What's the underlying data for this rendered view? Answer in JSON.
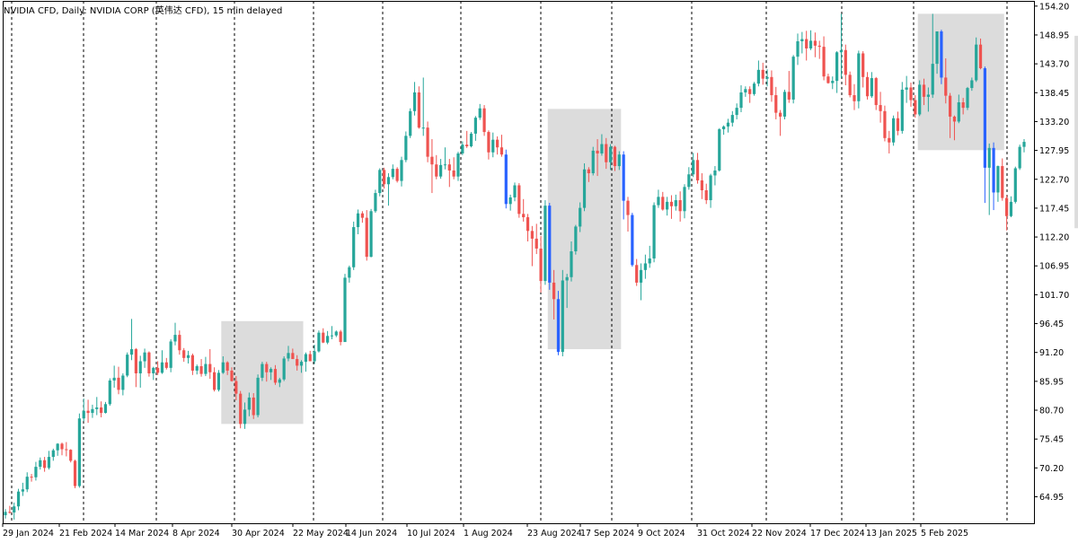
{
  "window": {
    "title": "NVIDIA CFD, Daily:  NVIDIA CORP (英伟达 CFD), 15 min delayed"
  },
  "colors": {
    "up": "#26a69a",
    "down": "#ef5350",
    "down_strong": "#2962ff",
    "box": "#dcdcdc",
    "grid": "#000000",
    "axis": "#000000",
    "background": "#ffffff"
  },
  "chart_data": {
    "type": "candlestick",
    "title": "NVIDIA CFD, Daily:  NVIDIA CORP (英伟达 CFD), 15 min delayed",
    "ylim": [
      60.0,
      155.0
    ],
    "y_ticks": [
      "154.20",
      "148.95",
      "143.70",
      "138.45",
      "133.20",
      "127.95",
      "122.70",
      "117.45",
      "112.20",
      "106.95",
      "101.70",
      "96.45",
      "91.20",
      "85.95",
      "80.70",
      "75.45",
      "70.20",
      "64.95"
    ],
    "x_ticks": [
      "29 Jan 2024",
      "21 Feb 2024",
      "14 Mar 2024",
      "8 Apr 2024",
      "30 Apr 2024",
      "22 May 2024",
      "14 Jun 2024",
      "10 Jul 2024",
      "1 Aug 2024",
      "23 Aug 2024",
      "17 Sep 2024",
      "9 Oct 2024",
      "31 Oct 2024",
      "22 Nov 2024",
      "17 Dec 2024",
      "13 Jan 2025",
      "5 Feb 2025"
    ],
    "grid": "vertical dashed",
    "boxes": [
      {
        "x_start": 50,
        "x_end": 68,
        "y_top": 96.9,
        "y_bottom": 78.2
      },
      {
        "x_start": 125,
        "x_end": 141,
        "y_top": 135.5,
        "y_bottom": 91.8
      },
      {
        "x_start": 210,
        "x_end": 229,
        "y_top": 152.8,
        "y_bottom": 128.0
      },
      {
        "x_start": 246,
        "x_end": 251,
        "y_top": 148.8,
        "y_bottom": 113.8
      }
    ],
    "candles": [
      [
        61.6,
        62.7,
        61.0,
        62.2
      ],
      [
        62.2,
        63.3,
        61.9,
        62.1
      ],
      [
        62.1,
        63.9,
        60.8,
        63.2
      ],
      [
        63.2,
        66.4,
        62.5,
        65.9
      ],
      [
        65.9,
        67.5,
        65.1,
        66.3
      ],
      [
        66.3,
        69.4,
        65.8,
        68.6
      ],
      [
        68.6,
        69.1,
        67.7,
        68.5
      ],
      [
        68.5,
        71.3,
        67.9,
        70.4
      ],
      [
        70.4,
        72.1,
        69.9,
        71.6
      ],
      [
        71.6,
        72.2,
        69.5,
        70.2
      ],
      [
        70.2,
        73.3,
        69.9,
        72.2
      ],
      [
        72.2,
        73.7,
        71.5,
        73.4
      ],
      [
        73.4,
        74.7,
        72.4,
        74.6
      ],
      [
        74.6,
        74.8,
        72.5,
        73.6
      ],
      [
        73.6,
        74.9,
        72.3,
        73.5
      ],
      [
        73.5,
        73.6,
        71.2,
        71.5
      ],
      [
        71.5,
        71.7,
        66.5,
        66.9
      ],
      [
        66.9,
        80.1,
        66.6,
        79.2
      ],
      [
        79.2,
        82.8,
        78.7,
        80.6
      ],
      [
        80.6,
        82.6,
        78.4,
        80.2
      ],
      [
        80.2,
        81.7,
        79.3,
        80.9
      ],
      [
        80.9,
        83.1,
        79.8,
        81.2
      ],
      [
        81.2,
        82.3,
        79.4,
        80.2
      ],
      [
        80.2,
        82.2,
        80.1,
        81.8
      ],
      [
        81.8,
        86.5,
        81.5,
        86.1
      ],
      [
        86.1,
        88.8,
        84.8,
        86.6
      ],
      [
        86.6,
        88.6,
        83.6,
        84.4
      ],
      [
        84.4,
        87.4,
        83.4,
        87.0
      ],
      [
        87.0,
        91.2,
        86.7,
        90.8
      ],
      [
        90.8,
        97.3,
        89.8,
        91.8
      ],
      [
        91.8,
        92.0,
        84.9,
        87.4
      ],
      [
        87.4,
        90.6,
        84.8,
        89.6
      ],
      [
        89.6,
        91.9,
        88.4,
        91.2
      ],
      [
        91.2,
        91.4,
        86.8,
        87.4
      ],
      [
        87.4,
        88.6,
        86.2,
        88.4
      ],
      [
        88.4,
        89.6,
        87.1,
        87.5
      ],
      [
        87.5,
        91.6,
        87.3,
        89.4
      ],
      [
        89.4,
        90.2,
        88.1,
        88.4
      ],
      [
        88.4,
        93.6,
        87.6,
        93.2
      ],
      [
        93.2,
        96.6,
        92.5,
        94.4
      ],
      [
        94.4,
        95.2,
        90.8,
        91.6
      ],
      [
        91.6,
        92.0,
        89.5,
        90.2
      ],
      [
        90.2,
        91.5,
        89.2,
        90.7
      ],
      [
        90.7,
        91.0,
        87.1,
        87.9
      ],
      [
        87.9,
        89.0,
        87.2,
        88.7
      ],
      [
        88.7,
        90.0,
        86.8,
        87.3
      ],
      [
        87.3,
        90.4,
        86.9,
        89.1
      ],
      [
        89.1,
        91.8,
        86.4,
        87.6
      ],
      [
        87.6,
        88.5,
        84.1,
        84.4
      ],
      [
        84.4,
        88.0,
        84.1,
        87.5
      ],
      [
        87.5,
        90.5,
        87.3,
        89.4
      ],
      [
        89.4,
        89.6,
        87.1,
        87.9
      ],
      [
        87.9,
        88.5,
        85.9,
        86.0
      ],
      [
        86.0,
        86.9,
        82.5,
        83.7
      ],
      [
        83.7,
        84.2,
        77.4,
        78.2
      ],
      [
        78.2,
        82.1,
        77.3,
        80.8
      ],
      [
        80.8,
        83.9,
        79.6,
        83.0
      ],
      [
        83.0,
        83.8,
        79.1,
        79.8
      ],
      [
        79.8,
        87.2,
        79.4,
        86.6
      ],
      [
        86.6,
        89.5,
        86.0,
        89.1
      ],
      [
        89.1,
        89.5,
        85.9,
        87.6
      ],
      [
        87.6,
        88.5,
        86.2,
        88.2
      ],
      [
        88.2,
        88.9,
        85.3,
        85.7
      ],
      [
        85.7,
        86.6,
        84.9,
        86.3
      ],
      [
        86.3,
        90.5,
        86.0,
        90.1
      ],
      [
        90.1,
        92.4,
        89.6,
        91.1
      ],
      [
        91.1,
        91.9,
        90.0,
        90.0
      ],
      [
        90.0,
        90.7,
        87.9,
        88.8
      ],
      [
        88.8,
        89.8,
        87.5,
        89.5
      ],
      [
        89.5,
        91.2,
        87.7,
        90.9
      ],
      [
        90.9,
        91.5,
        89.6,
        89.6
      ],
      [
        89.6,
        92.6,
        89.1,
        91.4
      ],
      [
        91.4,
        95.2,
        91.2,
        94.8
      ],
      [
        94.8,
        95.6,
        92.9,
        93.0
      ],
      [
        93.0,
        95.1,
        92.7,
        94.2
      ],
      [
        94.2,
        96.0,
        93.6,
        94.3
      ],
      [
        94.3,
        95.2,
        94.0,
        95.0
      ],
      [
        95.0,
        95.3,
        92.5,
        93.1
      ],
      [
        93.1,
        105.5,
        102.8,
        104.8
      ],
      [
        104.8,
        107.0,
        103.9,
        106.7
      ],
      [
        106.7,
        115.0,
        106.2,
        114.0
      ],
      [
        114.0,
        117.2,
        112.7,
        116.5
      ],
      [
        116.5,
        116.9,
        114.8,
        115.7
      ],
      [
        115.7,
        117.1,
        107.9,
        108.6
      ],
      [
        108.6,
        117.3,
        108.5,
        116.9
      ],
      [
        116.9,
        120.8,
        116.6,
        120.2
      ],
      [
        120.2,
        124.7,
        119.6,
        124.4
      ],
      [
        124.4,
        124.8,
        121.0,
        121.8
      ],
      [
        121.8,
        123.8,
        117.9,
        123.1
      ],
      [
        123.1,
        125.4,
        122.7,
        124.6
      ],
      [
        124.6,
        124.9,
        122.1,
        122.4
      ],
      [
        122.4,
        126.8,
        121.4,
        126.2
      ],
      [
        126.2,
        131.4,
        125.8,
        130.6
      ],
      [
        130.6,
        135.6,
        130.2,
        135.1
      ],
      [
        135.1,
        140.4,
        134.3,
        138.5
      ],
      [
        138.5,
        139.6,
        131.9,
        132.1
      ],
      [
        132.1,
        141.2,
        130.6,
        132.1
      ],
      [
        132.1,
        133.2,
        125.8,
        126.8
      ],
      [
        126.8,
        130.0,
        120.2,
        125.4
      ],
      [
        125.4,
        127.1,
        122.7,
        123.2
      ],
      [
        123.2,
        126.4,
        122.8,
        125.3
      ],
      [
        125.3,
        128.5,
        124.5,
        125.4
      ],
      [
        125.4,
        126.4,
        121.3,
        124.3
      ],
      [
        124.3,
        126.7,
        122.7,
        123.2
      ],
      [
        123.2,
        127.7,
        122.4,
        127.4
      ],
      [
        127.4,
        129.6,
        127.1,
        129.0
      ],
      [
        129.0,
        131.5,
        128.4,
        128.7
      ],
      [
        128.7,
        131.3,
        128.5,
        131.0
      ],
      [
        131.0,
        134.2,
        129.7,
        133.9
      ],
      [
        133.9,
        136.4,
        133.5,
        135.6
      ],
      [
        135.6,
        136.2,
        130.6,
        131.3
      ],
      [
        131.3,
        131.6,
        126.3,
        127.6
      ],
      [
        127.6,
        131.2,
        126.7,
        129.9
      ],
      [
        129.9,
        130.5,
        127.2,
        128.5
      ],
      [
        128.5,
        130.8,
        126.8,
        127.2
      ],
      [
        127.2,
        128.1,
        117.4,
        118.2
      ],
      [
        118.2,
        119.9,
        117.0,
        119.4
      ],
      [
        119.4,
        122.1,
        118.7,
        121.6
      ],
      [
        121.6,
        122.0,
        115.7,
        116.4
      ],
      [
        116.4,
        119.1,
        115.0,
        115.8
      ],
      [
        115.8,
        116.4,
        111.4,
        113.3
      ],
      [
        113.3,
        114.2,
        106.9,
        111.9
      ],
      [
        111.9,
        114.6,
        109.1,
        110.1
      ],
      [
        110.1,
        112.4,
        102.1,
        104.2
      ],
      [
        104.2,
        118.9,
        103.5,
        117.9
      ],
      [
        117.9,
        118.4,
        102.6,
        103.9
      ],
      [
        103.9,
        106.2,
        97.2,
        100.9
      ],
      [
        100.9,
        102.4,
        90.7,
        91.3
      ],
      [
        91.3,
        106.2,
        90.5,
        104.3
      ],
      [
        104.3,
        105.5,
        99.3,
        104.9
      ],
      [
        104.9,
        111.4,
        104.1,
        109.6
      ],
      [
        109.6,
        114.4,
        109.0,
        114.1
      ],
      [
        114.1,
        118.5,
        113.1,
        117.5
      ],
      [
        117.5,
        125.6,
        116.9,
        124.5
      ],
      [
        124.5,
        124.9,
        122.2,
        123.8
      ],
      [
        123.8,
        128.6,
        123.4,
        127.9
      ],
      [
        127.9,
        130.0,
        123.3,
        127.4
      ],
      [
        127.4,
        130.9,
        127.0,
        129.1
      ],
      [
        129.1,
        130.2,
        124.6,
        125.8
      ],
      [
        125.8,
        129.1,
        124.4,
        128.6
      ],
      [
        128.6,
        128.8,
        124.2,
        125.1
      ],
      [
        125.1,
        127.8,
        124.4,
        127.2
      ],
      [
        127.2,
        127.8,
        115.4,
        118.8
      ],
      [
        118.8,
        119.5,
        113.2,
        116.2
      ],
      [
        116.2,
        116.6,
        106.8,
        107.1
      ],
      [
        107.1,
        108.2,
        103.3,
        103.9
      ],
      [
        103.9,
        107.4,
        100.7,
        106.2
      ],
      [
        106.2,
        109.0,
        104.6,
        107.4
      ],
      [
        107.4,
        110.6,
        106.6,
        108.3
      ],
      [
        108.3,
        118.5,
        107.6,
        118.0
      ],
      [
        118.0,
        120.8,
        117.5,
        119.5
      ],
      [
        119.5,
        120.4,
        117.0,
        117.2
      ],
      [
        117.2,
        119.5,
        116.1,
        118.6
      ],
      [
        118.6,
        119.8,
        115.5,
        117.8
      ],
      [
        117.8,
        119.9,
        117.0,
        118.9
      ],
      [
        118.9,
        120.5,
        115.0,
        116.9
      ],
      [
        116.9,
        121.8,
        115.6,
        121.3
      ],
      [
        121.3,
        124.9,
        120.8,
        123.6
      ],
      [
        123.6,
        127.5,
        123.1,
        126.2
      ],
      [
        126.2,
        127.5,
        121.9,
        122.5
      ],
      [
        122.5,
        123.8,
        119.1,
        120.7
      ],
      [
        120.7,
        121.9,
        118.2,
        118.9
      ],
      [
        118.9,
        123.7,
        117.5,
        123.4
      ],
      [
        123.4,
        125.1,
        121.6,
        124.3
      ],
      [
        124.3,
        132.0,
        124.1,
        131.8
      ],
      [
        131.8,
        132.5,
        130.8,
        132.3
      ],
      [
        132.3,
        133.7,
        131.2,
        133.0
      ],
      [
        133.0,
        135.1,
        132.3,
        134.4
      ],
      [
        134.4,
        136.5,
        133.6,
        135.7
      ],
      [
        135.7,
        139.8,
        134.9,
        138.5
      ],
      [
        138.5,
        139.6,
        137.7,
        139.1
      ],
      [
        139.1,
        139.6,
        136.6,
        138.2
      ],
      [
        138.2,
        140.4,
        137.9,
        140.1
      ],
      [
        140.1,
        144.3,
        139.6,
        142.6
      ],
      [
        142.6,
        143.9,
        139.9,
        141.0
      ],
      [
        141.0,
        142.7,
        139.6,
        141.3
      ],
      [
        141.3,
        142.5,
        136.8,
        138.0
      ],
      [
        138.0,
        139.5,
        133.6,
        134.8
      ],
      [
        134.8,
        135.3,
        130.6,
        134.1
      ],
      [
        134.1,
        139.0,
        133.6,
        138.6
      ],
      [
        138.6,
        142.4,
        136.6,
        137.2
      ],
      [
        137.2,
        145.3,
        136.5,
        145.0
      ],
      [
        145.0,
        149.2,
        143.5,
        147.8
      ],
      [
        147.8,
        149.5,
        145.6,
        148.2
      ],
      [
        148.2,
        149.7,
        144.3,
        146.5
      ],
      [
        146.5,
        149.8,
        146.2,
        147.9
      ],
      [
        147.9,
        149.4,
        144.9,
        147.0
      ],
      [
        147.0,
        147.9,
        144.6,
        146.8
      ],
      [
        146.8,
        148.7,
        140.7,
        141.4
      ],
      [
        141.4,
        141.9,
        140.1,
        140.2
      ],
      [
        140.2,
        141.4,
        139.1,
        140.6
      ],
      [
        140.6,
        146.0,
        138.4,
        145.8
      ],
      [
        145.8,
        152.8,
        141.1,
        146.2
      ],
      [
        146.2,
        147.2,
        139.8,
        141.7
      ],
      [
        141.7,
        142.3,
        137.6,
        138.0
      ],
      [
        138.0,
        140.0,
        135.3,
        136.9
      ],
      [
        136.9,
        146.1,
        135.6,
        145.6
      ],
      [
        145.6,
        146.0,
        139.4,
        141.3
      ],
      [
        141.3,
        142.2,
        137.2,
        137.8
      ],
      [
        137.8,
        142.2,
        137.5,
        141.1
      ],
      [
        141.1,
        141.3,
        135.3,
        136.2
      ],
      [
        136.2,
        138.6,
        133.0,
        135.1
      ],
      [
        135.1,
        136.1,
        129.6,
        130.2
      ],
      [
        130.2,
        131.5,
        127.4,
        129.4
      ],
      [
        129.4,
        134.3,
        128.8,
        133.8
      ],
      [
        133.8,
        135.0,
        130.7,
        131.5
      ],
      [
        131.5,
        140.4,
        131.0,
        139.0
      ],
      [
        139.0,
        141.5,
        136.6,
        139.4
      ],
      [
        139.4,
        140.3,
        135.9,
        137.1
      ],
      [
        137.1,
        138.0,
        133.9,
        134.5
      ],
      [
        134.5,
        140.7,
        134.2,
        139.9
      ],
      [
        139.9,
        141.0,
        136.2,
        137.7
      ],
      [
        137.7,
        139.4,
        135.0,
        138.1
      ],
      [
        138.1,
        152.8,
        137.5,
        143.7
      ],
      [
        143.7,
        148.6,
        141.9,
        149.6
      ],
      [
        149.6,
        149.9,
        140.0,
        141.2
      ],
      [
        141.2,
        144.7,
        136.5,
        137.9
      ],
      [
        137.9,
        138.4,
        130.2,
        134.1
      ],
      [
        134.1,
        134.3,
        129.8,
        133.2
      ],
      [
        133.2,
        138.1,
        132.9,
        136.7
      ],
      [
        136.7,
        137.5,
        134.5,
        135.7
      ],
      [
        135.7,
        139.5,
        135.3,
        139.3
      ],
      [
        139.3,
        141.2,
        138.8,
        140.7
      ],
      [
        140.7,
        148.5,
        140.4,
        147.2
      ],
      [
        147.2,
        148.3,
        142.7,
        142.9
      ],
      [
        142.9,
        143.2,
        118.4,
        124.8
      ],
      [
        124.8,
        129.2,
        116.2,
        128.4
      ],
      [
        128.4,
        129.4,
        117.1,
        120.3
      ],
      [
        120.3,
        125.2,
        118.6,
        125.1
      ],
      [
        125.1,
        126.5,
        118.8,
        119.3
      ],
      [
        119.3,
        119.8,
        113.4,
        116.0
      ],
      [
        116.0,
        119.6,
        115.8,
        118.6
      ],
      [
        118.6,
        125.0,
        118.3,
        124.7
      ],
      [
        124.7,
        129.0,
        124.4,
        128.6
      ],
      [
        128.6,
        130.0,
        127.6,
        129.5
      ]
    ]
  }
}
